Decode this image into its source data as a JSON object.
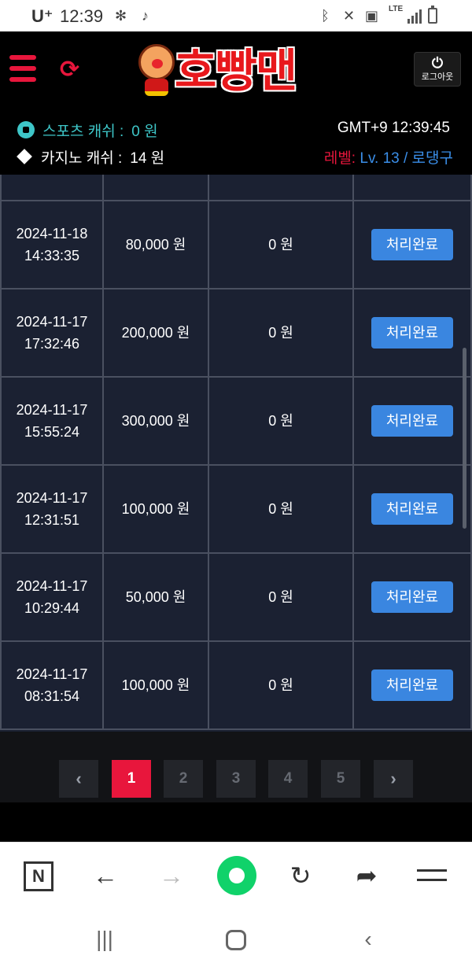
{
  "status_bar": {
    "carrier": "U⁺",
    "time": "12:39",
    "network": "LTE"
  },
  "header": {
    "logo_text": "호빵맨",
    "logout_label": "로그아웃",
    "accent_color": "#e8163c"
  },
  "info": {
    "sports_label": "스포츠 캐쉬 :",
    "sports_value": "0 원",
    "casino_label": "카지노 캐쉬 :",
    "casino_value": "14 원",
    "clock": "GMT+9 12:39:45",
    "level_label": "레벨:",
    "level_value": "Lv. 13 / 로댕구"
  },
  "table": {
    "rows": [
      {
        "date": "2024-11-18",
        "time": "14:33:35",
        "amount": "80,000 원",
        "bonus": "0 원",
        "status": "처리완료"
      },
      {
        "date": "2024-11-17",
        "time": "17:32:46",
        "amount": "200,000 원",
        "bonus": "0 원",
        "status": "처리완료"
      },
      {
        "date": "2024-11-17",
        "time": "15:55:24",
        "amount": "300,000 원",
        "bonus": "0 원",
        "status": "처리완료"
      },
      {
        "date": "2024-11-17",
        "time": "12:31:51",
        "amount": "100,000 원",
        "bonus": "0 원",
        "status": "처리완료"
      },
      {
        "date": "2024-11-17",
        "time": "10:29:44",
        "amount": "50,000 원",
        "bonus": "0 원",
        "status": "처리완료"
      },
      {
        "date": "2024-11-17",
        "time": "08:31:54",
        "amount": "100,000 원",
        "bonus": "0 원",
        "status": "처리완료"
      }
    ]
  },
  "pagination": {
    "prev": "‹",
    "pages": [
      "1",
      "2",
      "3",
      "4",
      "5"
    ],
    "active_page": "1",
    "next": "›"
  },
  "browser_toolbar": {
    "items": [
      "naver-n-icon",
      "back-arrow-icon",
      "forward-arrow-icon",
      "green-home-icon",
      "reload-icon",
      "share-icon",
      "menu-icon"
    ],
    "n_label": "N"
  },
  "nav_bar": {
    "items": [
      "recent-apps-icon",
      "home-icon",
      "back-icon"
    ]
  }
}
